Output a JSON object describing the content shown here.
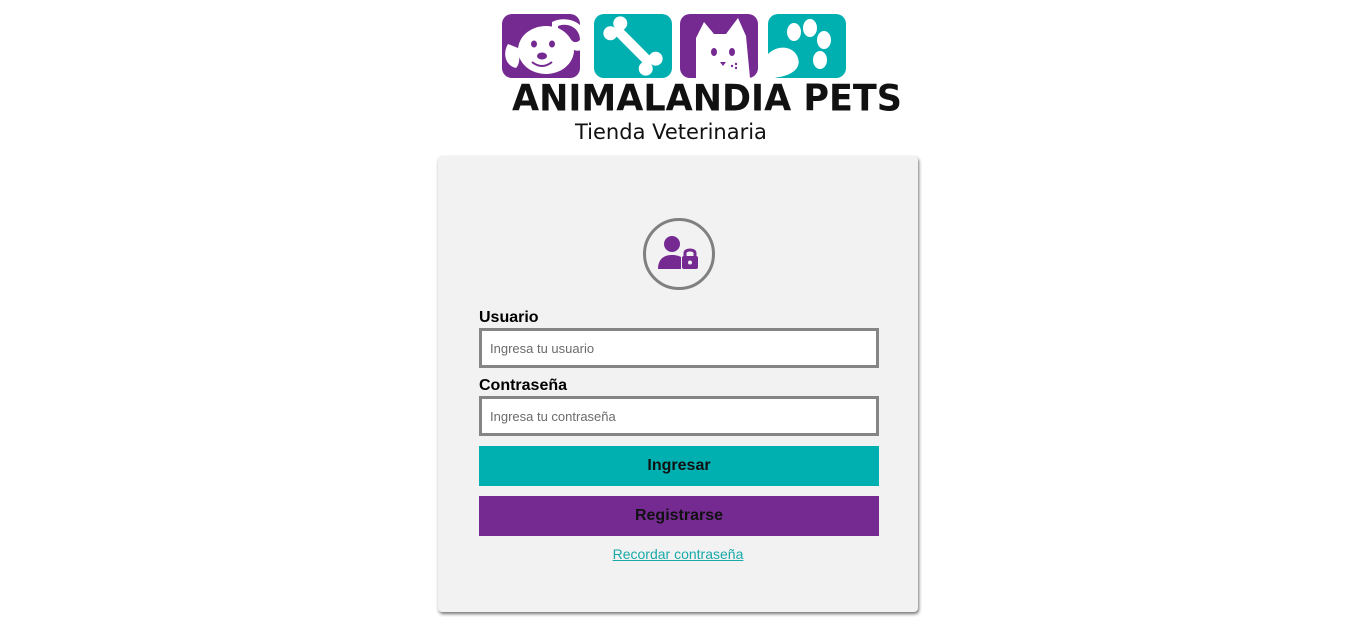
{
  "colors": {
    "teal": "#00b0b0",
    "purple": "#752a92",
    "card_bg": "#f2f2f2",
    "link": "#1aa9a9"
  },
  "logo": {
    "brand": "ANIMALANDIA PETS",
    "tagline": "Tienda Veterinaria",
    "tiles": [
      "dog-icon",
      "bone-icon",
      "cat-icon",
      "paw-icon"
    ]
  },
  "login": {
    "avatar_icon": "user-lock-icon",
    "username_label": "Usuario",
    "username_placeholder": "Ingresa tu usuario",
    "password_label": "Contraseña",
    "password_placeholder": "Ingresa tu contraseña",
    "login_button": "Ingresar",
    "register_button": "Registrarse",
    "forgot_link": "Recordar contraseña"
  }
}
